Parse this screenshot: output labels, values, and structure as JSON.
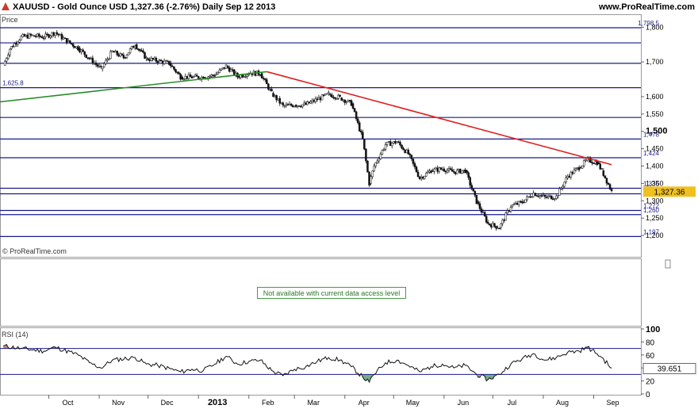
{
  "header": {
    "title": "XAUUSD - Gold Ounce USD    1,327.36 (-2.76%)    Daily  Sep 12 2013",
    "site": "www.ProRealTime.com",
    "logo_icon": "prorealtime-logo-icon"
  },
  "chart_data": [
    {
      "type": "candlestick",
      "title": "Price",
      "source_label": "© ProRealTime.com",
      "current_price_label": "1,327.36",
      "current_price": 1327.36,
      "current_price_color": "#f0c020",
      "ylim": [
        1175,
        1810
      ],
      "y_ticks": [
        {
          "label": "1,800",
          "value": 1800
        },
        {
          "label": "1,700",
          "value": 1700
        },
        {
          "label": "1,600",
          "value": 1600
        },
        {
          "label": "1,550",
          "value": 1550
        },
        {
          "label": "1,500",
          "value": 1500
        },
        {
          "label": "1,450",
          "value": 1450
        },
        {
          "label": "1,400",
          "value": 1400
        },
        {
          "label": "1,350",
          "value": 1350
        },
        {
          "label": "1,300",
          "value": 1300
        },
        {
          "label": "1,250",
          "value": 1250
        },
        {
          "label": "1,200",
          "value": 1200
        }
      ],
      "y_tick_bold": "1,500",
      "horizontal_levels": [
        {
          "label": "1,798.5",
          "value": 1798.5
        },
        {
          "label": "",
          "value": 1755
        },
        {
          "label": "",
          "value": 1696
        },
        {
          "label": "1,625.8",
          "value": 1625.8
        },
        {
          "label": "",
          "value": 1540
        },
        {
          "label": "1,478",
          "value": 1478
        },
        {
          "label": "1,424",
          "value": 1424
        },
        {
          "label": "1,336",
          "value": 1336
        },
        {
          "label": "1,320",
          "value": 1320
        },
        {
          "label": "1,272",
          "value": 1272
        },
        {
          "label": "1,260",
          "value": 1260
        },
        {
          "label": "1,197",
          "value": 1197
        }
      ],
      "level_color": "#1a1a8c",
      "x_labels": [
        "Oct",
        "Nov",
        "Dec",
        "2013",
        "Feb",
        "Mar",
        "Apr",
        "May",
        "Jun",
        "Jul",
        "Aug",
        "Sep"
      ],
      "x_label_bold": "2013",
      "trendlines": [
        {
          "name": "green-trendline",
          "color": "#2a8a2a",
          "points": [
            [
              "2012-09-01",
              1585
            ],
            [
              "2013-02-12",
              1672
            ]
          ]
        },
        {
          "name": "red-trendline",
          "color": "#e02020",
          "points": [
            [
              "2013-02-12",
              1672
            ],
            [
              "2013-09-12",
              1404
            ]
          ]
        }
      ],
      "series": [
        {
          "date": "2012-09-03",
          "close": 1690
        },
        {
          "date": "2012-09-07",
          "close": 1738
        },
        {
          "date": "2012-09-14",
          "close": 1772
        },
        {
          "date": "2012-09-21",
          "close": 1776
        },
        {
          "date": "2012-09-28",
          "close": 1772
        },
        {
          "date": "2012-10-05",
          "close": 1785
        },
        {
          "date": "2012-10-12",
          "close": 1760
        },
        {
          "date": "2012-10-19",
          "close": 1740
        },
        {
          "date": "2012-10-26",
          "close": 1710
        },
        {
          "date": "2012-11-02",
          "close": 1680
        },
        {
          "date": "2012-11-09",
          "close": 1730
        },
        {
          "date": "2012-11-16",
          "close": 1713
        },
        {
          "date": "2012-11-23",
          "close": 1750
        },
        {
          "date": "2012-11-30",
          "close": 1710
        },
        {
          "date": "2012-12-07",
          "close": 1703
        },
        {
          "date": "2012-12-14",
          "close": 1696
        },
        {
          "date": "2012-12-21",
          "close": 1657
        },
        {
          "date": "2012-12-28",
          "close": 1656
        },
        {
          "date": "2013-01-04",
          "close": 1656
        },
        {
          "date": "2013-01-11",
          "close": 1662
        },
        {
          "date": "2013-01-18",
          "close": 1688
        },
        {
          "date": "2013-01-25",
          "close": 1658
        },
        {
          "date": "2013-02-01",
          "close": 1668
        },
        {
          "date": "2013-02-08",
          "close": 1667
        },
        {
          "date": "2013-02-15",
          "close": 1610
        },
        {
          "date": "2013-02-22",
          "close": 1573
        },
        {
          "date": "2013-03-01",
          "close": 1576
        },
        {
          "date": "2013-03-08",
          "close": 1577
        },
        {
          "date": "2013-03-15",
          "close": 1592
        },
        {
          "date": "2013-03-22",
          "close": 1607
        },
        {
          "date": "2013-03-29",
          "close": 1597
        },
        {
          "date": "2013-04-05",
          "close": 1580
        },
        {
          "date": "2013-04-12",
          "close": 1477
        },
        {
          "date": "2013-04-16",
          "close": 1350
        },
        {
          "date": "2013-04-19",
          "close": 1400
        },
        {
          "date": "2013-04-26",
          "close": 1462
        },
        {
          "date": "2013-05-03",
          "close": 1470
        },
        {
          "date": "2013-05-10",
          "close": 1435
        },
        {
          "date": "2013-05-17",
          "close": 1365
        },
        {
          "date": "2013-05-24",
          "close": 1387
        },
        {
          "date": "2013-05-31",
          "close": 1392
        },
        {
          "date": "2013-06-07",
          "close": 1383
        },
        {
          "date": "2013-06-14",
          "close": 1387
        },
        {
          "date": "2013-06-21",
          "close": 1297
        },
        {
          "date": "2013-06-28",
          "close": 1234
        },
        {
          "date": "2013-07-05",
          "close": 1223
        },
        {
          "date": "2013-07-12",
          "close": 1284
        },
        {
          "date": "2013-07-19",
          "close": 1296
        },
        {
          "date": "2013-07-26",
          "close": 1322
        },
        {
          "date": "2013-08-02",
          "close": 1310
        },
        {
          "date": "2013-08-09",
          "close": 1312
        },
        {
          "date": "2013-08-16",
          "close": 1371
        },
        {
          "date": "2013-08-23",
          "close": 1396
        },
        {
          "date": "2013-08-28",
          "close": 1418
        },
        {
          "date": "2013-09-03",
          "close": 1410
        },
        {
          "date": "2013-09-06",
          "close": 1387
        },
        {
          "date": "2013-09-12",
          "close": 1327
        }
      ]
    },
    {
      "type": "empty",
      "notice": "Not available with current data access level"
    },
    {
      "type": "line",
      "title": "RSI (14)",
      "current_label": "39.651",
      "current_value": 39.651,
      "ylim": [
        0,
        100
      ],
      "y_ticks": [
        {
          "label": "100",
          "value": 100
        },
        {
          "label": "80",
          "value": 80
        },
        {
          "label": "60",
          "value": 60
        },
        {
          "label": "40",
          "value": 40
        },
        {
          "label": "20",
          "value": 20
        },
        {
          "label": "0",
          "value": 0
        }
      ],
      "overbought": 70,
      "oversold": 30,
      "overbought_fill": "#c07070",
      "oversold_fill": "#5aa070",
      "series": [
        {
          "date": "2012-09-03",
          "value": 74
        },
        {
          "date": "2012-09-14",
          "value": 70
        },
        {
          "date": "2012-09-28",
          "value": 66
        },
        {
          "date": "2012-10-05",
          "value": 72
        },
        {
          "date": "2012-10-19",
          "value": 60
        },
        {
          "date": "2012-10-26",
          "value": 48
        },
        {
          "date": "2012-11-02",
          "value": 40
        },
        {
          "date": "2012-11-09",
          "value": 52
        },
        {
          "date": "2012-11-23",
          "value": 56
        },
        {
          "date": "2012-11-30",
          "value": 46
        },
        {
          "date": "2012-12-07",
          "value": 44
        },
        {
          "date": "2012-12-21",
          "value": 34
        },
        {
          "date": "2012-12-28",
          "value": 38
        },
        {
          "date": "2013-01-04",
          "value": 36
        },
        {
          "date": "2013-01-11",
          "value": 46
        },
        {
          "date": "2013-01-18",
          "value": 58
        },
        {
          "date": "2013-01-25",
          "value": 46
        },
        {
          "date": "2013-02-01",
          "value": 50
        },
        {
          "date": "2013-02-08",
          "value": 52
        },
        {
          "date": "2013-02-15",
          "value": 36
        },
        {
          "date": "2013-02-22",
          "value": 28
        },
        {
          "date": "2013-03-01",
          "value": 38
        },
        {
          "date": "2013-03-08",
          "value": 42
        },
        {
          "date": "2013-03-15",
          "value": 50
        },
        {
          "date": "2013-03-22",
          "value": 56
        },
        {
          "date": "2013-03-29",
          "value": 52
        },
        {
          "date": "2013-04-05",
          "value": 42
        },
        {
          "date": "2013-04-12",
          "value": 26
        },
        {
          "date": "2013-04-16",
          "value": 18
        },
        {
          "date": "2013-04-19",
          "value": 30
        },
        {
          "date": "2013-04-26",
          "value": 48
        },
        {
          "date": "2013-05-03",
          "value": 52
        },
        {
          "date": "2013-05-10",
          "value": 44
        },
        {
          "date": "2013-05-17",
          "value": 34
        },
        {
          "date": "2013-05-24",
          "value": 42
        },
        {
          "date": "2013-05-31",
          "value": 46
        },
        {
          "date": "2013-06-07",
          "value": 40
        },
        {
          "date": "2013-06-14",
          "value": 44
        },
        {
          "date": "2013-06-21",
          "value": 30
        },
        {
          "date": "2013-06-28",
          "value": 22
        },
        {
          "date": "2013-07-05",
          "value": 30
        },
        {
          "date": "2013-07-12",
          "value": 46
        },
        {
          "date": "2013-07-19",
          "value": 54
        },
        {
          "date": "2013-07-26",
          "value": 62
        },
        {
          "date": "2013-08-02",
          "value": 52
        },
        {
          "date": "2013-08-09",
          "value": 56
        },
        {
          "date": "2013-08-16",
          "value": 64
        },
        {
          "date": "2013-08-23",
          "value": 66
        },
        {
          "date": "2013-08-28",
          "value": 72
        },
        {
          "date": "2013-09-03",
          "value": 62
        },
        {
          "date": "2013-09-06",
          "value": 56
        },
        {
          "date": "2013-09-12",
          "value": 39.651
        }
      ]
    }
  ]
}
